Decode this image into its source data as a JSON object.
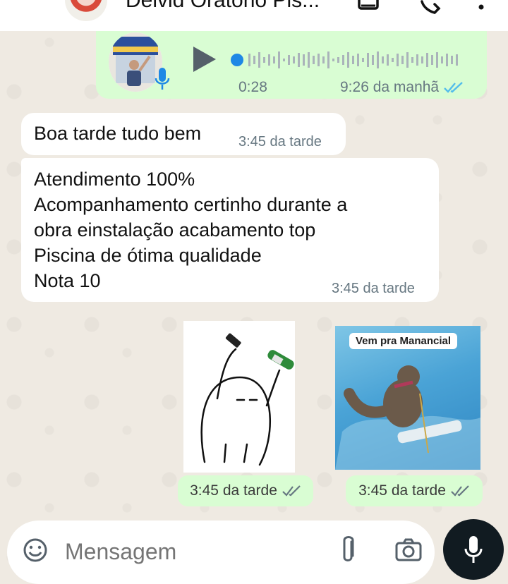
{
  "header": {
    "contact_name": "Delvid Oratono Pis...",
    "back_icon": "arrow-left-icon",
    "icons": [
      "video-call-icon",
      "phone-icon",
      "more-vert-icon"
    ]
  },
  "voice_message": {
    "duration": "0:28",
    "time": "9:26 da manhã"
  },
  "messages": [
    {
      "text": "Boa tarde tudo bem",
      "time": "3:45 da tarde"
    },
    {
      "lines": [
        "Atendimento 100%",
        "Acompanhamento certinho durante a",
        "obra einstalação acabamento top",
        "Piscina de ótima qualidade",
        "Nota 10"
      ],
      "time": "3:45 da tarde"
    }
  ],
  "stickers": [
    {
      "time": "3:45 da tarde"
    },
    {
      "label": "Vem pra Manancial",
      "time": "3:45 da tarde"
    }
  ],
  "composer": {
    "placeholder": "Mensagem"
  },
  "colors": {
    "incoming": "#ffffff",
    "outgoing": "#d9fdd3",
    "read_ticks": "#53bdeb",
    "wallpaper": "#efeae2",
    "send_button": "#111b21"
  }
}
